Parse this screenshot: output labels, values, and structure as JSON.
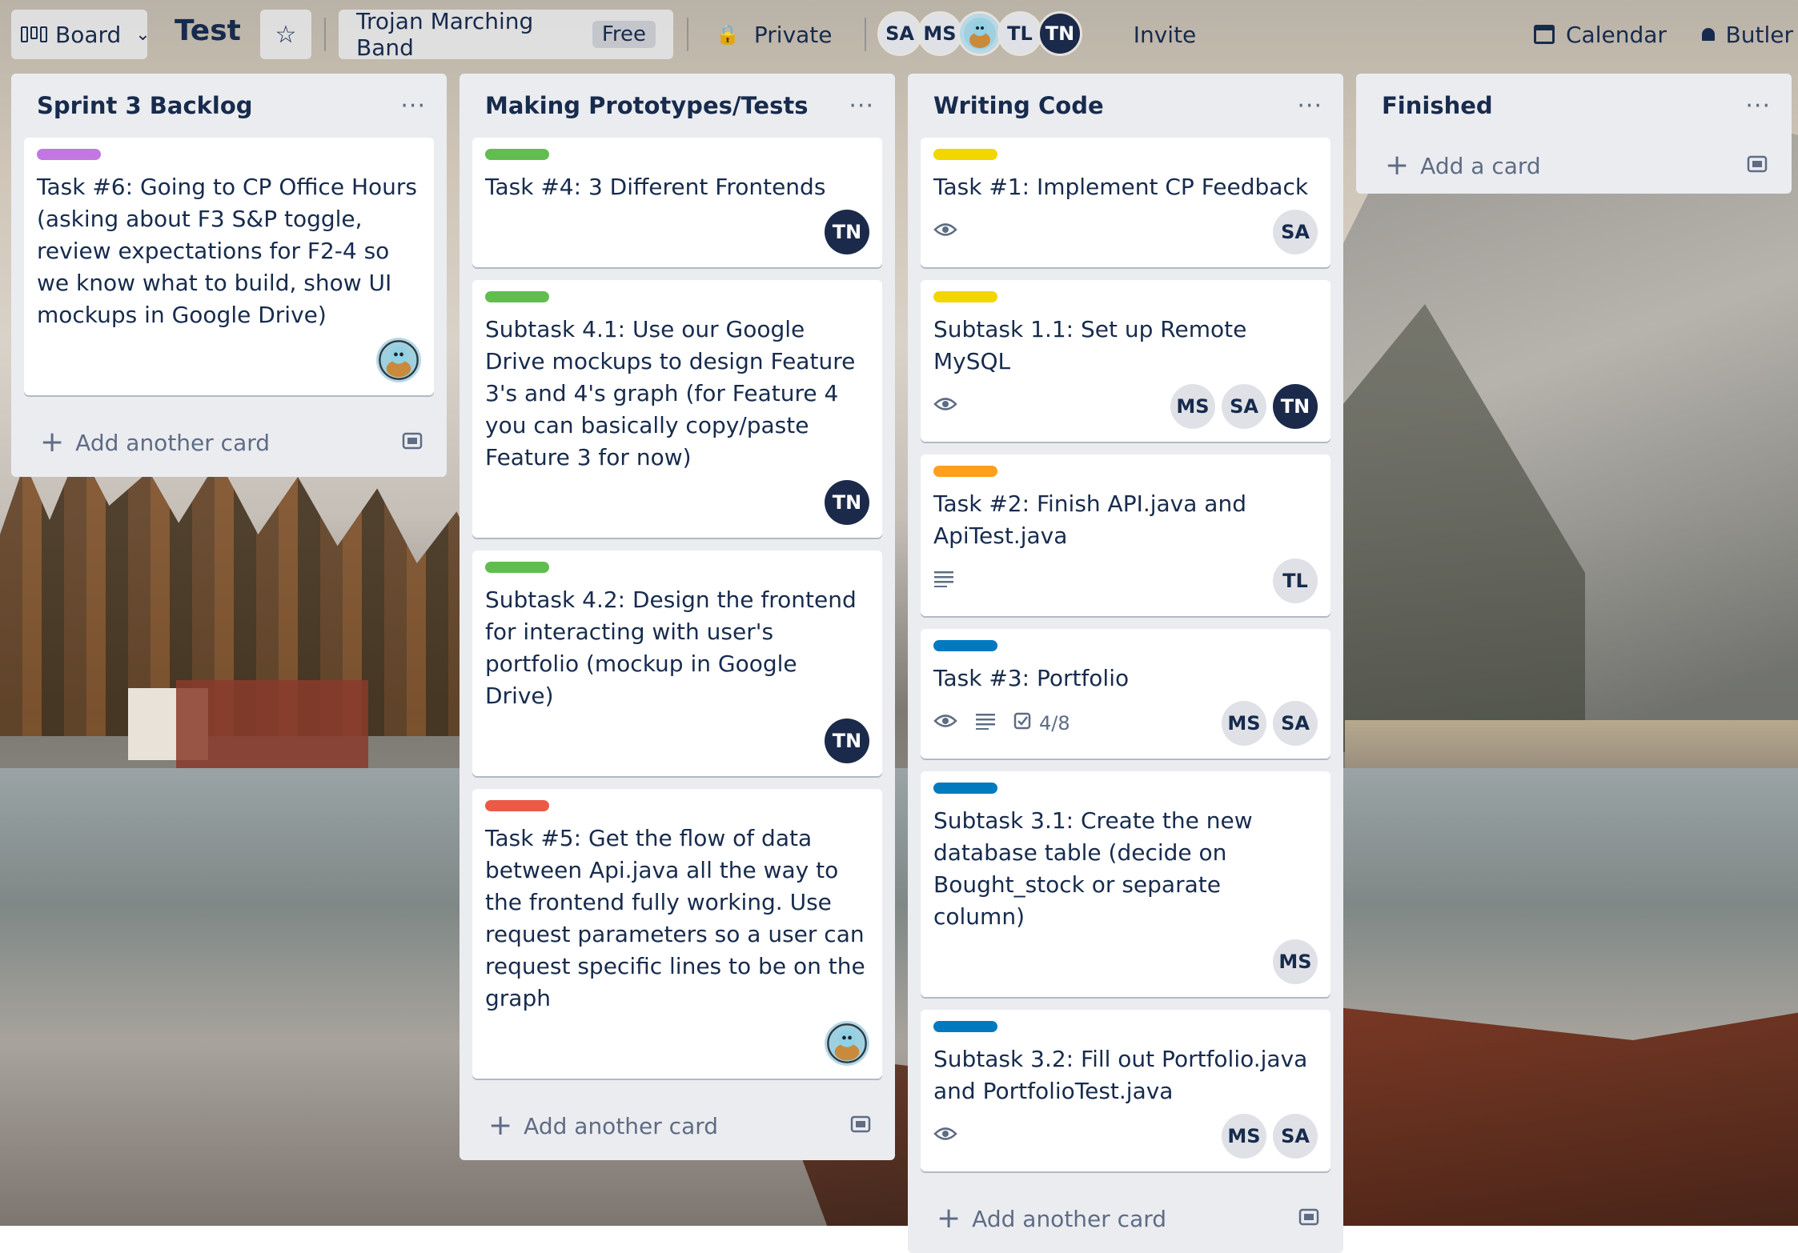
{
  "topbar": {
    "board_menu": "Board",
    "board_title": "Test",
    "team": "Trojan Marching Band",
    "team_plan": "Free",
    "visibility": "Private",
    "invite": "Invite",
    "calendar": "Calendar",
    "butler": "Butler",
    "members": [
      "SA",
      "MS",
      "",
      "TL",
      "TN"
    ]
  },
  "lists": [
    {
      "title": "Sprint 3 Backlog",
      "add_label": "Add another card",
      "cards": [
        {
          "label_color": "#c377e0",
          "title": "Task #6: Going to CP Office Hours (asking about F3 S&P toggle, review expectations for F2-4 so we know what to build, show UI mockups in Google Drive)",
          "avatars": [
            "turtle"
          ]
        }
      ]
    },
    {
      "title": "Making Prototypes/Tests",
      "add_label": "Add another card",
      "cards": [
        {
          "label_color": "#61bd4f",
          "title": "Task #4: 3 Different Frontends",
          "avatars": [
            "TN"
          ]
        },
        {
          "label_color": "#61bd4f",
          "title": "Subtask 4.1: Use our Google Drive mockups to design Feature 3's and 4's graph (for Feature 4 you can basically copy/paste Feature 3 for now)",
          "avatars": [
            "TN"
          ]
        },
        {
          "label_color": "#61bd4f",
          "title": "Subtask 4.2: Design the frontend for interacting with user's portfolio (mockup in Google Drive)",
          "avatars": [
            "TN"
          ]
        },
        {
          "label_color": "#eb5a46",
          "title": "Task #5: Get the flow of data between Api.java all the way to the frontend fully working. Use request parameters so a user can request specific lines to be on the graph",
          "avatars": [
            "turtle"
          ]
        }
      ]
    },
    {
      "title": "Writing Code",
      "add_label": "Add another card",
      "cards": [
        {
          "label_color": "#f2d600",
          "title": "Task #1: Implement CP Feedback",
          "watch": true,
          "avatars": [
            "SA"
          ]
        },
        {
          "label_color": "#f2d600",
          "title": "Subtask 1.1: Set up Remote MySQL",
          "watch": true,
          "avatars": [
            "MS",
            "SA",
            "TN"
          ]
        },
        {
          "label_color": "#ff9f1a",
          "title": "Task #2: Finish API.java and ApiTest.java",
          "desc": true,
          "avatars": [
            "TL"
          ]
        },
        {
          "label_color": "#0079bf",
          "title": "Task #3: Portfolio",
          "watch": true,
          "desc": true,
          "checklist": "4/8",
          "avatars": [
            "MS",
            "SA"
          ]
        },
        {
          "label_color": "#0079bf",
          "title": "Subtask 3.1: Create the new database table (decide on Bought_stock or separate column)",
          "avatars": [
            "MS"
          ]
        },
        {
          "label_color": "#0079bf",
          "title": "Subtask 3.2: Fill out Portfolio.java and PortfolioTest.java",
          "watch": true,
          "avatars": [
            "MS",
            "SA"
          ]
        }
      ]
    },
    {
      "title": "Finished",
      "add_label": "Add a card",
      "cards": []
    }
  ]
}
